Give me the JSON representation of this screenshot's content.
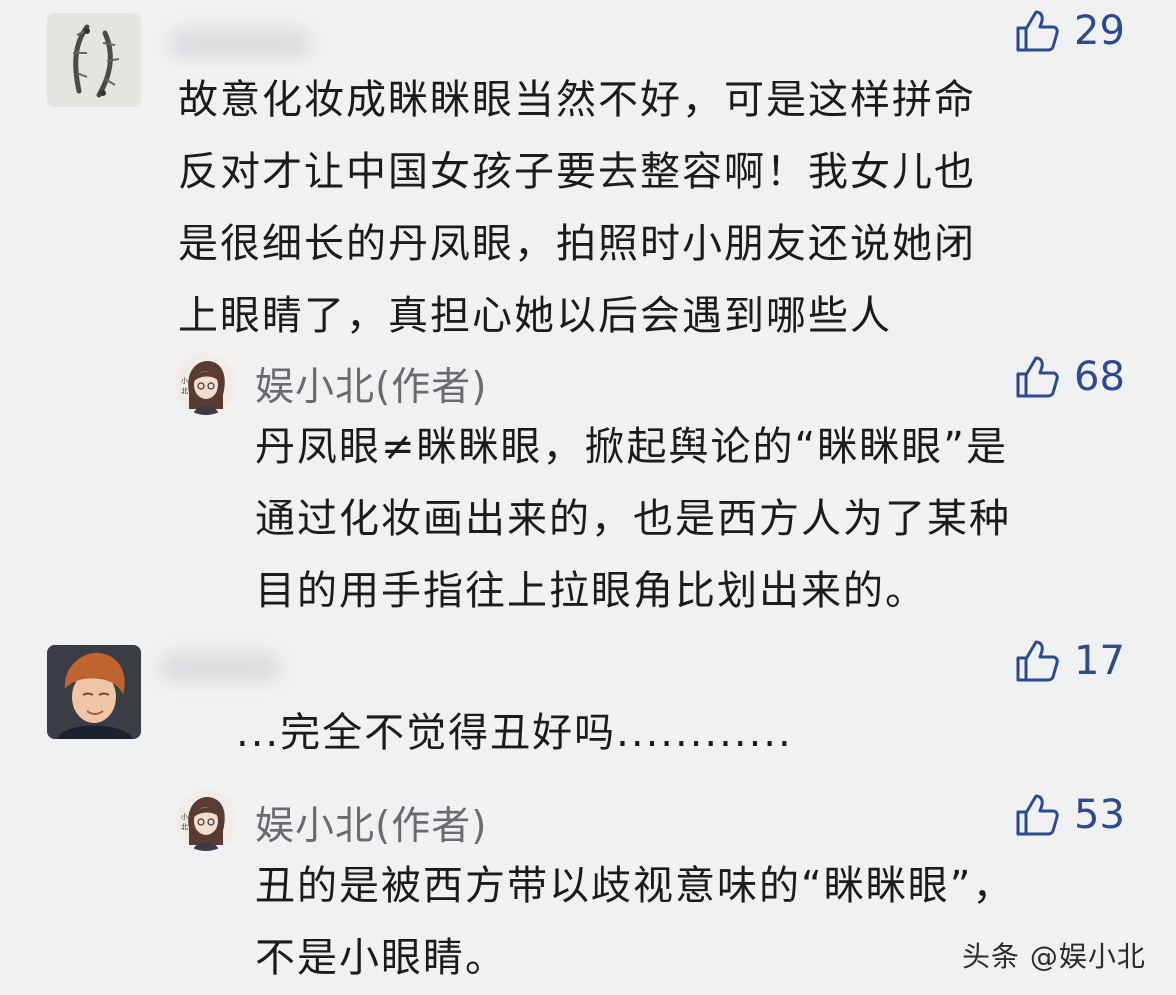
{
  "comments": [
    {
      "likes": "29",
      "lines": [
        "故意化妆成眯眯眼当然不好，可是这样拼命",
        "反对才让中国女孩子要去整容啊！我女儿也",
        "是很细长的丹凤眼，拍照时小朋友还说她闭",
        "上眼睛了，真担心她以后会遇到哪些人"
      ],
      "reply": {
        "author": "娱小北(作者)",
        "avatar_text": "小北",
        "likes": "68",
        "lines": [
          "丹凤眼≠眯眯眼，掀起舆论的“眯眯眼”是",
          "通过化妆画出来的，也是西方人为了某种",
          "目的用手指往上拉眼角比划出来的。"
        ]
      }
    },
    {
      "likes": "17",
      "lines": [
        "...完全不觉得丑好吗............"
      ],
      "reply": {
        "author": "娱小北(作者)",
        "avatar_text": "小北",
        "likes": "53",
        "lines": [
          "丑的是被西方带以歧视意味的“眯眯眼”，",
          "不是小眼睛。"
        ]
      }
    }
  ],
  "watermark": "头条 @娱小北",
  "colors": {
    "accent": "#2e4a8e",
    "background": "#f0f1f3"
  }
}
